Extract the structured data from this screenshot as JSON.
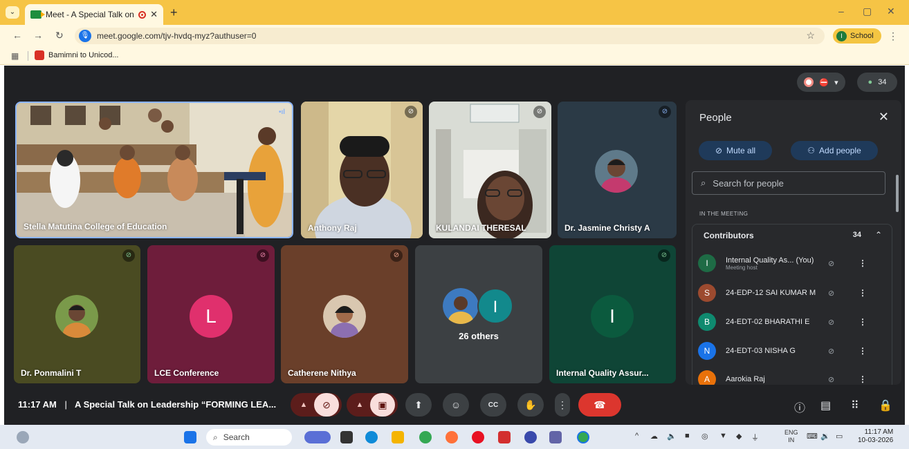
{
  "browser": {
    "tab_title": "Meet - A Special Talk on Le",
    "tab_close": "✕",
    "new_tab": "+",
    "url": "meet.google.com/tjv-hvdq-myz?authuser=0",
    "profile_initial": "I",
    "profile_name": "School",
    "bookmark": "Bamimni to Unicod...",
    "window_controls": [
      "–",
      "▢",
      "✕"
    ]
  },
  "meet": {
    "participant_count": "34",
    "tiles": [
      {
        "name": "Stella Matutina College of Education"
      },
      {
        "name": "Anthony Raj"
      },
      {
        "name": "KULANDAI THERESAL"
      },
      {
        "name": "Dr. Jasmine Christy A"
      },
      {
        "name": "Dr. Ponmalini T"
      },
      {
        "name": "LCE Conference",
        "initial": "L"
      },
      {
        "name": "Catherene Nithya"
      },
      {
        "name": "26 others",
        "initial": "I"
      },
      {
        "name": "Internal Quality Assur...",
        "initial": "I"
      }
    ],
    "time": "11:17 AM",
    "separator": "|",
    "meeting_title": "A Special Talk on Leadership “FORMING LEA..."
  },
  "people_panel": {
    "title": "People",
    "mute_all": "Mute all",
    "add_people": "Add people",
    "search_placeholder": "Search for people",
    "section_label": "IN THE MEETING",
    "group_label": "Contributors",
    "group_count": "34",
    "participants": [
      {
        "initial": "I",
        "name": "Internal Quality As... (You)",
        "sub": "Meeting host",
        "color": "#1e6b45"
      },
      {
        "initial": "S",
        "name": "24-EDP-12 SAI KUMAR M",
        "sub": "",
        "color": "#9c4a2f"
      },
      {
        "initial": "B",
        "name": "24-EDT-02 BHARATHI E",
        "sub": "",
        "color": "#0f8a6f"
      },
      {
        "initial": "N",
        "name": "24-EDT-03 NISHA G",
        "sub": "",
        "color": "#1a73e8"
      },
      {
        "initial": "A",
        "name": "Aarokia Raj",
        "sub": "",
        "color": "#e8710a"
      }
    ]
  },
  "taskbar": {
    "search": "Search",
    "lang_line1": "ENG",
    "lang_line2": "IN",
    "clock_time": "11:17 AM",
    "clock_date": "10-03-2026"
  }
}
